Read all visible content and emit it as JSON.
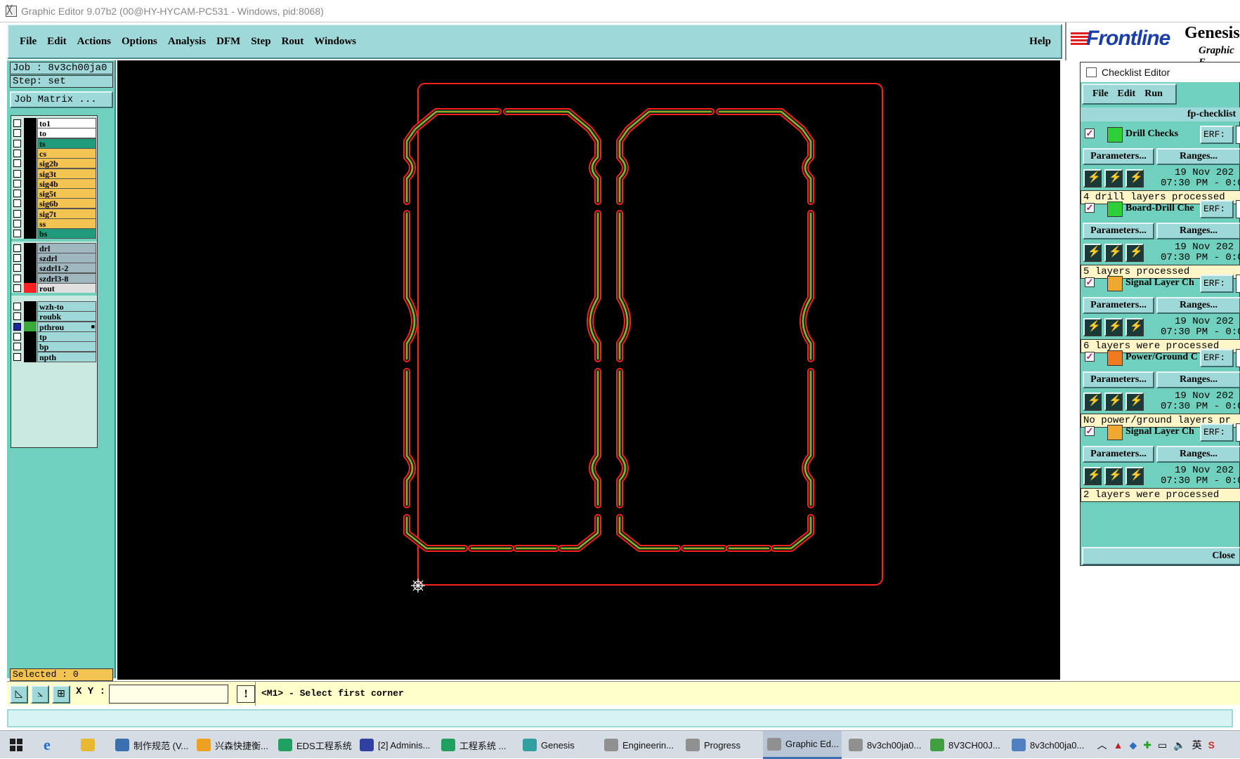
{
  "window": {
    "title": "Graphic Editor 9.07b2 (00@HY-HYCAM-PC531 - Windows, pid:8068)"
  },
  "menu": {
    "items": [
      "File",
      "Edit",
      "Actions",
      "Options",
      "Analysis",
      "DFM",
      "Step",
      "Rout",
      "Windows"
    ],
    "help": "Help"
  },
  "logo": {
    "brand": "Frontline",
    "product": "Genesis",
    "sub": "Graphic E"
  },
  "job": {
    "job": "Job : 8v3ch00ja0",
    "step": "Step: set",
    "matrix_button": "Job Matrix ..."
  },
  "layers": [
    {
      "name": "to1",
      "color": "#ffffff",
      "swatch": "#000000"
    },
    {
      "name": "to",
      "color": "#ffffff",
      "swatch": "#000000"
    },
    {
      "name": "ts",
      "color": "#1f9a7a",
      "swatch": "#000000"
    },
    {
      "name": "cs",
      "color": "#f3c452",
      "swatch": "#000000"
    },
    {
      "name": "sig2b",
      "color": "#f3c452",
      "swatch": "#000000"
    },
    {
      "name": "sig3t",
      "color": "#f3c452",
      "swatch": "#000000"
    },
    {
      "name": "sig4b",
      "color": "#f3c452",
      "swatch": "#000000"
    },
    {
      "name": "sig5t",
      "color": "#f3c452",
      "swatch": "#000000"
    },
    {
      "name": "sig6b",
      "color": "#f3c452",
      "swatch": "#000000"
    },
    {
      "name": "sig7t",
      "color": "#f3c452",
      "swatch": "#000000"
    },
    {
      "name": "ss",
      "color": "#f3c452",
      "swatch": "#000000"
    },
    {
      "name": "bs",
      "color": "#1f9a7a",
      "swatch": "#000000"
    },
    {
      "name": "drl",
      "color": "#9fb8c0",
      "swatch": "#000000"
    },
    {
      "name": "szdrl",
      "color": "#9fb8c0",
      "swatch": "#000000"
    },
    {
      "name": "szdrl1-2",
      "color": "#9fb8c0",
      "swatch": "#000000"
    },
    {
      "name": "szdrl3-8",
      "color": "#9fb8c0",
      "swatch": "#000000"
    },
    {
      "name": "rout",
      "color": "#e0e0e0",
      "swatch": "#ff2020"
    },
    {
      "name": "wzh-to",
      "color": "#9fd8d8",
      "swatch": "#000000"
    },
    {
      "name": "roubk",
      "color": "#9fd8d8",
      "swatch": "#000000"
    },
    {
      "name": "pthrou",
      "color": "#9fd8d8",
      "swatch": "#3aa83a",
      "checked": true,
      "marker": "■"
    },
    {
      "name": "tp",
      "color": "#9fd8d8",
      "swatch": "#000000"
    },
    {
      "name": "bp",
      "color": "#9fd8d8",
      "swatch": "#000000"
    },
    {
      "name": "npth",
      "color": "#9fd8d8",
      "swatch": "#000000"
    }
  ],
  "selected": "Selected : 0",
  "checklist": {
    "title": "Checklist Editor",
    "menu": [
      "File",
      "Edit",
      "Run"
    ],
    "name": "fp-checklist",
    "actions": [
      {
        "name": "Drill Checks",
        "erf": "ERF:",
        "params": "Parameters...",
        "ranges": "Ranges...",
        "date1": "19 Nov 202",
        "date2": "07:30 PM - 0:0",
        "status": "4 drill layers processed",
        "icon_color": "#2fcf3a"
      },
      {
        "name": "Board-Drill Che",
        "erf": "ERF:",
        "params": "Parameters...",
        "ranges": "Ranges...",
        "date1": "19 Nov 202",
        "date2": "07:30 PM - 0:0",
        "status": "5 layers processed",
        "icon_color": "#2fcf3a"
      },
      {
        "name": "Signal Layer Ch",
        "erf": "ERF:",
        "params": "Parameters...",
        "ranges": "Ranges...",
        "date1": "19 Nov 202",
        "date2": "07:30 PM - 0:0",
        "status": "6 layers were processed",
        "icon_color": "#f0a830"
      },
      {
        "name": "Power/Ground C",
        "erf": "ERF:",
        "params": "Parameters...",
        "ranges": "Ranges...",
        "date1": "19 Nov 202",
        "date2": "07:30 PM - 0:0",
        "status": "No power/ground layers pr",
        "icon_color": "#f07a20"
      },
      {
        "name": "Signal Layer Ch",
        "erf": "ERF:",
        "params": "Parameters...",
        "ranges": "Ranges...",
        "date1": "19 Nov 202",
        "date2": "07:30 PM - 0:0",
        "status": "2 layers were processed",
        "icon_color": "#f0a830"
      }
    ],
    "close": "Close"
  },
  "xybar": {
    "label": "X Y :",
    "value": "",
    "exclaim": "!",
    "prompt": "<M1> - Select first corner"
  },
  "taskbar": {
    "items": [
      {
        "label": "制作规范 (V...",
        "color": "#3a6fb0"
      },
      {
        "label": "兴森快捷衡...",
        "color": "#f0a020"
      },
      {
        "label": "EDS工程系统",
        "color": "#20a060"
      },
      {
        "label": "[2] Adminis...",
        "color": "#3040a0"
      },
      {
        "label": "工程系统 ...",
        "color": "#20a060"
      },
      {
        "label": "Genesis",
        "color": "#30a0a0"
      },
      {
        "label": "Engineerin...",
        "color": "#909090"
      },
      {
        "label": "Progress",
        "color": "#909090"
      },
      {
        "label": "Graphic Ed...",
        "color": "#909090",
        "active": true
      },
      {
        "label": "8v3ch00ja0...",
        "color": "#909090"
      },
      {
        "label": "8V3CH00J...",
        "color": "#40a040"
      },
      {
        "label": "8v3ch00ja0...",
        "color": "#5080c0"
      }
    ],
    "tray_lang": "英"
  }
}
